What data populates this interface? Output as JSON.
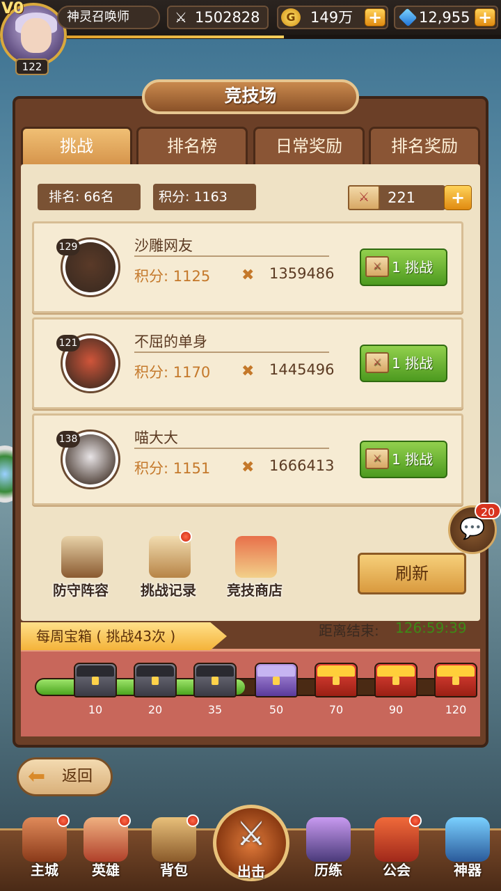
{
  "player": {
    "vip": "V0",
    "level": "122",
    "name": "神灵召唤师",
    "power": "1502828",
    "gold": "149万",
    "gems": "12,955",
    "gold_icon_glyph": "G",
    "xp_fraction": 0.5
  },
  "arena": {
    "title": "竞技场",
    "tabs": [
      {
        "label": "挑战",
        "active": true
      },
      {
        "label": "排名榜",
        "active": false
      },
      {
        "label": "日常奖励",
        "active": false
      },
      {
        "label": "排名奖励",
        "active": false
      }
    ],
    "rank": "排名: 66名",
    "score": "积分: 1163",
    "tickets": "221"
  },
  "opponents": [
    {
      "level": "129",
      "name": "沙雕网友",
      "score": "积分: 1125",
      "power": "1359486",
      "button": "1 挑战",
      "avatar_color": "#5a3a28"
    },
    {
      "level": "121",
      "name": "不屈的单身",
      "score": "积分: 1170",
      "power": "1445496",
      "button": "1 挑战",
      "avatar_color": "#d0553a"
    },
    {
      "level": "138",
      "name": "喵大大",
      "score": "积分: 1151",
      "power": "1666413",
      "button": "1 挑战",
      "avatar_color": "#e8e4e6"
    }
  ],
  "menu": [
    {
      "label": "防守阵容",
      "icon": "chess-icon",
      "dot": false
    },
    {
      "label": "挑战记录",
      "icon": "scroll-sword-icon",
      "dot": true
    },
    {
      "label": "竞技商店",
      "icon": "shop-icon",
      "dot": false
    }
  ],
  "refresh_label": "刷新",
  "chat_badge": "20",
  "weekly": {
    "title": "每周宝箱 ( 挑战43次 )",
    "countdown_label": "距离结束:",
    "countdown": "126:59:39",
    "progress_fraction": 0.48,
    "chests": [
      {
        "label": "10",
        "state": "opened"
      },
      {
        "label": "20",
        "state": "opened"
      },
      {
        "label": "35",
        "state": "opened"
      },
      {
        "label": "50",
        "state": "locked"
      },
      {
        "label": "70",
        "state": "locked"
      },
      {
        "label": "90",
        "state": "locked"
      },
      {
        "label": "120",
        "state": "locked"
      }
    ]
  },
  "back_label": "返回",
  "nav": [
    {
      "label": "主城",
      "icon": "castle-icon",
      "dot": true
    },
    {
      "label": "英雄",
      "icon": "hero-icon",
      "dot": true
    },
    {
      "label": "背包",
      "icon": "backpack-icon",
      "dot": true
    },
    {
      "label": "出击",
      "icon": "crossed-swords-icon",
      "dot": false
    },
    {
      "label": "历练",
      "icon": "tower-icon",
      "dot": false
    },
    {
      "label": "公会",
      "icon": "guild-shield-icon",
      "dot": true
    },
    {
      "label": "神器",
      "icon": "artifact-gem-icon",
      "dot": false
    }
  ],
  "colors": {
    "accent_green": "#3d8a16",
    "score_orange": "#c4782a",
    "panel_brown": "#6b3f27"
  }
}
